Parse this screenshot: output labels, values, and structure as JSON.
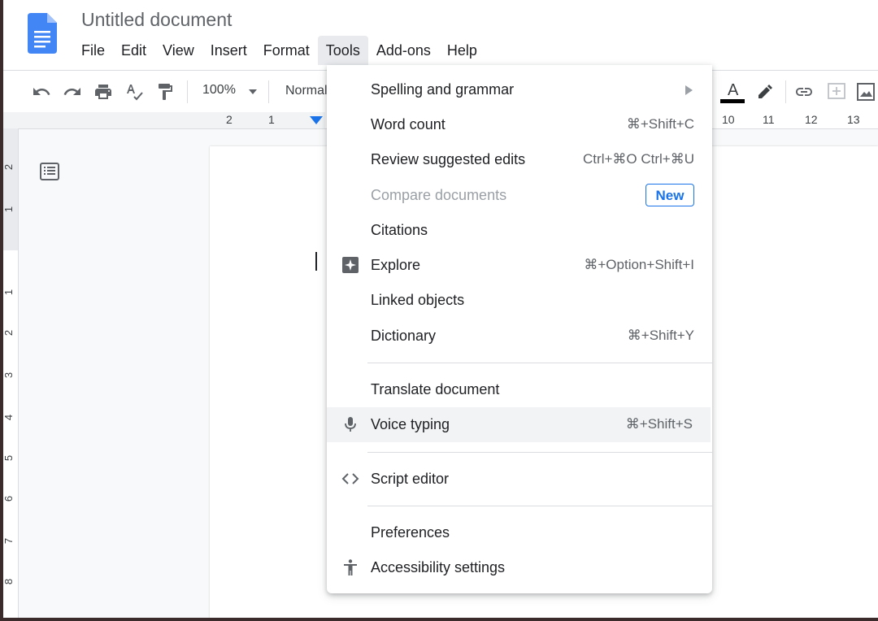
{
  "document": {
    "title": "Untitled document"
  },
  "menubar": {
    "items": [
      {
        "label": "File"
      },
      {
        "label": "Edit"
      },
      {
        "label": "View"
      },
      {
        "label": "Insert"
      },
      {
        "label": "Format"
      },
      {
        "label": "Tools"
      },
      {
        "label": "Add-ons"
      },
      {
        "label": "Help"
      }
    ],
    "active": "Tools"
  },
  "toolbar": {
    "zoom": "100%",
    "style": "Normal"
  },
  "ruler": {
    "left_numbers": [
      "2",
      "1"
    ],
    "right_numbers": [
      "10",
      "11",
      "12",
      "13"
    ],
    "vertical_numbers": [
      "2",
      "1",
      "1",
      "2",
      "3",
      "4",
      "5",
      "6",
      "7",
      "8"
    ]
  },
  "tools_menu": {
    "items": [
      {
        "label": "Spelling and grammar",
        "shortcut": "",
        "has_submenu": true
      },
      {
        "label": "Word count",
        "shortcut": "⌘+Shift+C"
      },
      {
        "label": "Review suggested edits",
        "shortcut": "Ctrl+⌘O Ctrl+⌘U"
      },
      {
        "label": "Compare documents",
        "badge": "New",
        "disabled": true
      },
      {
        "label": "Citations",
        "shortcut": ""
      },
      {
        "label": "Explore",
        "shortcut": "⌘+Option+Shift+I",
        "icon": "explore-icon"
      },
      {
        "label": "Linked objects",
        "shortcut": ""
      },
      {
        "label": "Dictionary",
        "shortcut": "⌘+Shift+Y"
      },
      {
        "label": "Translate document",
        "shortcut": ""
      },
      {
        "label": "Voice typing",
        "shortcut": "⌘+Shift+S",
        "icon": "microphone-icon",
        "hovered": true
      },
      {
        "label": "Script editor",
        "shortcut": "",
        "icon": "code-icon"
      },
      {
        "label": "Preferences",
        "shortcut": ""
      },
      {
        "label": "Accessibility settings",
        "shortcut": "",
        "icon": "accessibility-icon"
      }
    ]
  },
  "colors": {
    "brand_blue": "#4285f4",
    "accent_blue": "#1a73e8",
    "hover_gray": "#f1f3f4"
  }
}
